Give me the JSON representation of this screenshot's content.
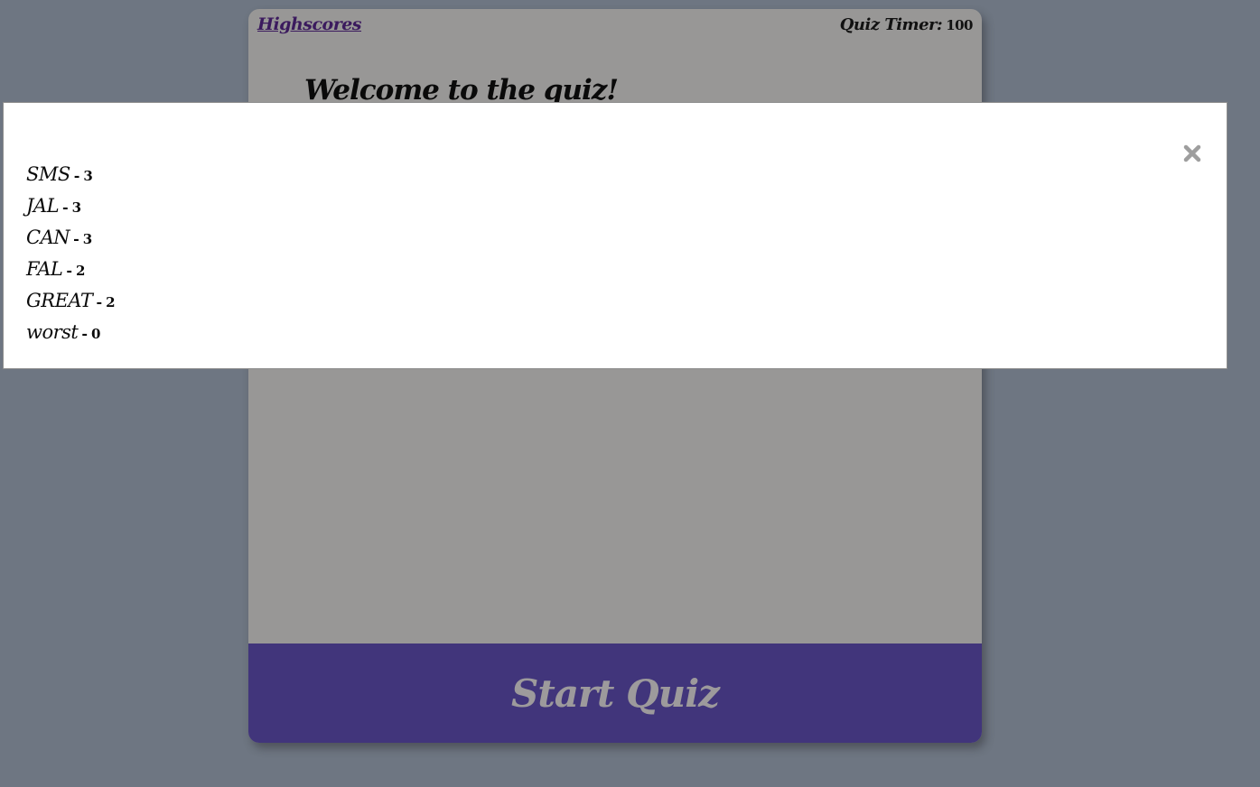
{
  "header": {
    "highscores_link": "Highscores",
    "timer_label": "Quiz Timer:",
    "timer_value": "100"
  },
  "main": {
    "title": "Welcome to the quiz!",
    "start_button_label": "Start Quiz"
  },
  "highscores_modal": {
    "close_icon": "close-icon",
    "separator": "-",
    "scores": [
      {
        "name": "SMS",
        "score": "3"
      },
      {
        "name": "JAL",
        "score": "3"
      },
      {
        "name": "CAN",
        "score": "3"
      },
      {
        "name": "FAL",
        "score": "2"
      },
      {
        "name": "GREAT",
        "score": "2"
      },
      {
        "name": "worst",
        "score": "0"
      }
    ]
  },
  "colors": {
    "page_background": "#6e7682",
    "card_background": "#989796",
    "start_bar": "#41357b",
    "start_text": "#9d9a9c",
    "link": "#3b1a5e",
    "modal_background": "#ffffff",
    "close_icon": "#9e9e9e"
  }
}
